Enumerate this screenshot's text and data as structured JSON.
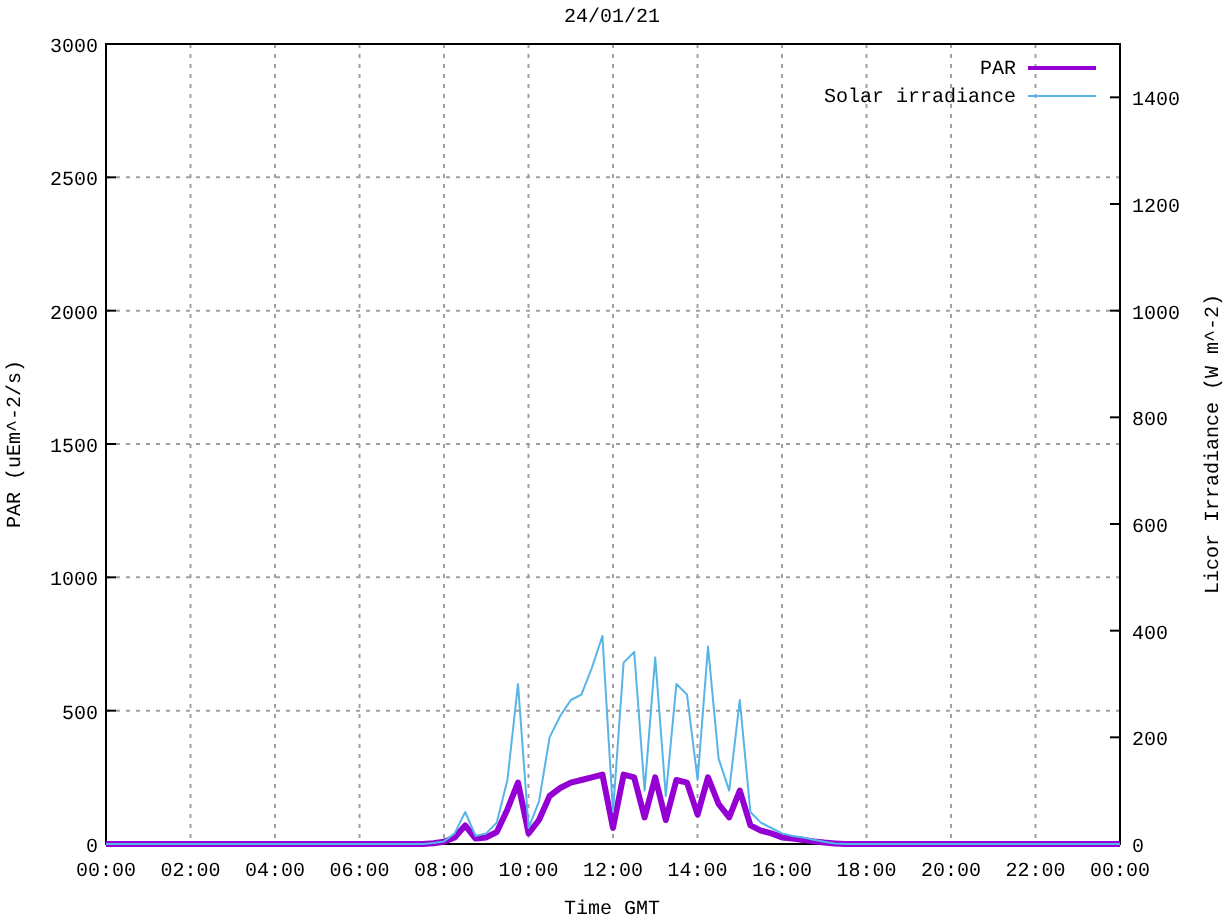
{
  "chart_data": {
    "type": "line",
    "title": "24/01/21",
    "xlabel": "Time GMT",
    "ylabel": "PAR (uEm^-2/s)",
    "y2label": "Licor Irradiance (W m^-2)",
    "x": [
      0,
      7.5,
      7.75,
      8,
      8.25,
      8.5,
      8.75,
      9,
      9.25,
      9.5,
      9.75,
      10,
      10.25,
      10.5,
      10.75,
      11,
      11.25,
      11.5,
      11.75,
      12,
      12.25,
      12.5,
      12.75,
      13,
      13.25,
      13.5,
      13.75,
      14,
      14.25,
      14.5,
      14.75,
      15,
      15.25,
      15.5,
      15.75,
      16,
      16.25,
      16.5,
      16.75,
      17,
      17.25,
      17.5,
      24
    ],
    "series": [
      {
        "name": "PAR",
        "color": "#9400d3",
        "axis": "y",
        "values": [
          0,
          0,
          3,
          8,
          25,
          70,
          20,
          25,
          45,
          130,
          230,
          40,
          90,
          180,
          210,
          230,
          240,
          250,
          260,
          60,
          260,
          250,
          100,
          250,
          90,
          240,
          230,
          110,
          250,
          150,
          100,
          200,
          70,
          50,
          40,
          25,
          20,
          15,
          10,
          5,
          2,
          0,
          0
        ]
      },
      {
        "name": "Solar irradiance",
        "color": "#56b4e9",
        "axis": "y2",
        "values": [
          0,
          0,
          2,
          5,
          20,
          60,
          15,
          20,
          40,
          120,
          300,
          30,
          80,
          200,
          240,
          270,
          280,
          330,
          390,
          60,
          340,
          360,
          100,
          350,
          90,
          300,
          280,
          120,
          370,
          160,
          100,
          270,
          60,
          40,
          30,
          20,
          15,
          12,
          8,
          4,
          1,
          0,
          0
        ]
      }
    ],
    "grid": true,
    "legend": true,
    "xlim": [
      0,
      24
    ],
    "ylim": [
      0,
      3000
    ],
    "y2lim": [
      0,
      1500
    ],
    "xticks": [
      {
        "value": 0,
        "label": "00:00"
      },
      {
        "value": 2,
        "label": "02:00"
      },
      {
        "value": 4,
        "label": "04:00"
      },
      {
        "value": 6,
        "label": "06:00"
      },
      {
        "value": 8,
        "label": "08:00"
      },
      {
        "value": 10,
        "label": "10:00"
      },
      {
        "value": 12,
        "label": "12:00"
      },
      {
        "value": 14,
        "label": "14:00"
      },
      {
        "value": 16,
        "label": "16:00"
      },
      {
        "value": 18,
        "label": "18:00"
      },
      {
        "value": 20,
        "label": "20:00"
      },
      {
        "value": 22,
        "label": "22:00"
      },
      {
        "value": 24,
        "label": "00:00"
      }
    ],
    "yticks": [
      0,
      500,
      1000,
      1500,
      2000,
      2500,
      3000
    ],
    "y2ticks": [
      0,
      200,
      400,
      600,
      800,
      1000,
      1200,
      1400
    ]
  }
}
